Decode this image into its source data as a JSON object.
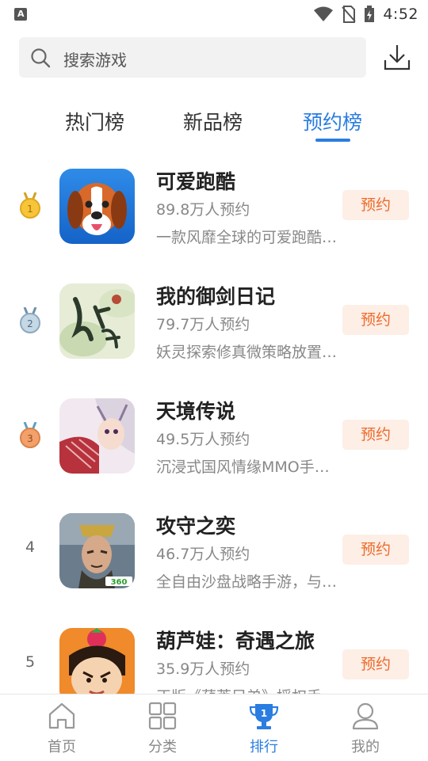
{
  "status_bar": {
    "time": "4:52"
  },
  "search": {
    "placeholder": "搜索游戏"
  },
  "tabs": [
    {
      "label": "热门榜",
      "active": false
    },
    {
      "label": "新品榜",
      "active": false
    },
    {
      "label": "预约榜",
      "active": true
    }
  ],
  "games": [
    {
      "rank": "1",
      "medal": "gold",
      "title": "可爱跑酷",
      "count": "89.8万人预约",
      "desc": "一款风靡全球的可爱跑酷…",
      "button": "预约"
    },
    {
      "rank": "2",
      "medal": "silver",
      "title": "我的御剑日记",
      "count": "79.7万人预约",
      "desc": "妖灵探索修真微策略放置…",
      "button": "预约"
    },
    {
      "rank": "3",
      "medal": "bronze",
      "title": "天境传说",
      "count": "49.5万人预约",
      "desc": "沉浸式国风情缘MMO手…",
      "button": "预约"
    },
    {
      "rank": "4",
      "medal": "",
      "title": "攻守之奕",
      "count": "46.7万人预约",
      "desc": "全自由沙盘战略手游，与…",
      "button": "预约"
    },
    {
      "rank": "5",
      "medal": "",
      "title": "葫芦娃：奇遇之旅",
      "count": "35.9万人预约",
      "desc": "正版《葫芦兄弟》授权手…",
      "button": "预约"
    }
  ],
  "bottom_nav": [
    {
      "label": "首页",
      "icon": "home-icon",
      "active": false
    },
    {
      "label": "分类",
      "icon": "grid-icon",
      "active": false
    },
    {
      "label": "排行",
      "icon": "trophy-icon",
      "active": true
    },
    {
      "label": "我的",
      "icon": "user-icon",
      "active": false
    }
  ],
  "colors": {
    "accent": "#2a7de1",
    "button_text": "#ee6a2a",
    "button_bg": "#fdeee6"
  }
}
